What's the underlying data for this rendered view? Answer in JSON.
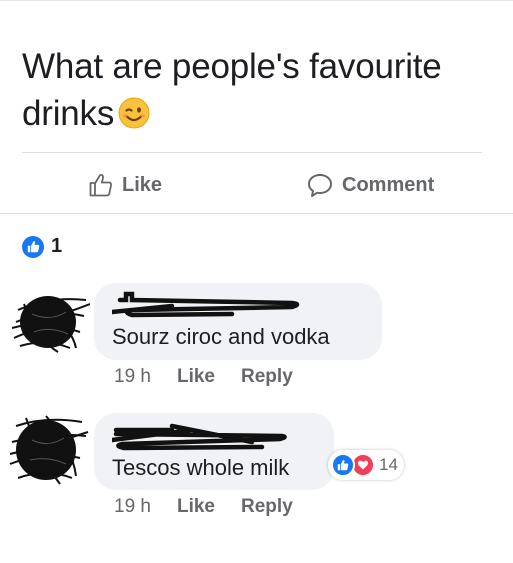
{
  "post": {
    "text": "What are people's favourite drinks",
    "emoji": "winking-face-emoji"
  },
  "actions": {
    "like_label": "Like",
    "comment_label": "Comment"
  },
  "reactions": {
    "count": "1",
    "icon": "thumbs-up-icon"
  },
  "comments": [
    {
      "text": "Sourz ciroc and vodka",
      "time": "19 h",
      "like_label": "Like",
      "reply_label": "Reply"
    },
    {
      "text": "Tescos whole milk",
      "time": "19 h",
      "like_label": "Like",
      "reply_label": "Reply",
      "reaction_count": "14",
      "reaction_icons": [
        "thumbs-up-icon",
        "heart-icon"
      ]
    }
  ],
  "colors": {
    "brand_blue": "#1877f2",
    "love_red": "#f33e58",
    "bubble_bg": "#f0f2f5",
    "secondary_text": "#65676b"
  }
}
